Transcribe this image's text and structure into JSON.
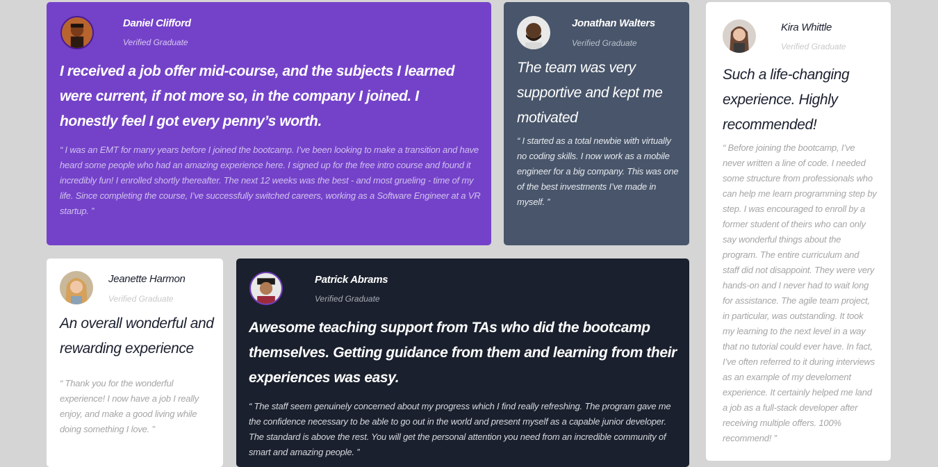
{
  "testimonials": [
    {
      "name": "Daniel Clifford",
      "role": "Verified Graduate",
      "headline": "I received a job offer mid-course, and the subjects I learned were current, if not more so, in the company I joined. I honestly feel I got every penny’s worth.",
      "quote": "“ I was an EMT for many years before I joined the bootcamp. I’ve been looking to make a transition and have heard some people who had an amazing experience here. I signed up for the free intro course and found it incredibly fun! I enrolled shortly thereafter. The next 12 weeks was the best - and most grueling - time of my life. Since completing the course, I’ve successfully switched careers, working as a Software Engineer at a VR startup. ”",
      "card_color": "#7442c9"
    },
    {
      "name": "Jonathan Walters",
      "role": "Verified Graduate",
      "headline": "The team was very supportive and kept me motivated",
      "quote": "“ I started as a total newbie with virtually no coding skills. I now work as a mobile engineer for a big company. This was one of the best investments I’ve made in myself. ”",
      "card_color": "#48556a"
    },
    {
      "name": "Kira Whittle",
      "role": "Verified Graduate",
      "headline": "Such a life-changing experience. Highly recommended!",
      "quote": "“ Before joining the bootcamp, I’ve never written a line of code. I needed some structure from professionals who can help me learn programming step by step. I was encouraged to enroll by a former student of theirs who can only say wonderful things about the program. The entire curriculum and staff did not disappoint. They were very hands-on and I never had to wait long for assistance. The agile team project, in particular, was outstanding. It took my learning to the next level in a way that no tutorial could ever have. In fact, I’ve often referred to it during interviews as an example of my develoment experience. It certainly helped me land a job as a full-stack developer after receiving multiple offers. 100% recommend! ”",
      "card_color": "#ffffff"
    },
    {
      "name": "Jeanette Harmon",
      "role": "Verified Graduate",
      "headline": "An overall wonderful and rewarding experience",
      "quote": "“ Thank you for the wonderful experience! I now have a job I really enjoy, and make a good living while doing something I love. ”",
      "card_color": "#ffffff"
    },
    {
      "name": "Patrick Abrams",
      "role": "Verified Graduate",
      "headline": "Awesome teaching support from TAs who did the bootcamp themselves. Getting guidance from them and learning from their experiences was easy.",
      "quote": "“ The staff seem genuinely concerned about my progress which I find really refreshing. The program gave me the confidence necessary to be able to go out in the world and present myself as a capable junior developer. The standard is above the rest. You will get the personal attention you need from an incredible community of smart and amazing people. ”",
      "card_color": "#1a202d"
    }
  ],
  "page_background": "#d5d5d5"
}
